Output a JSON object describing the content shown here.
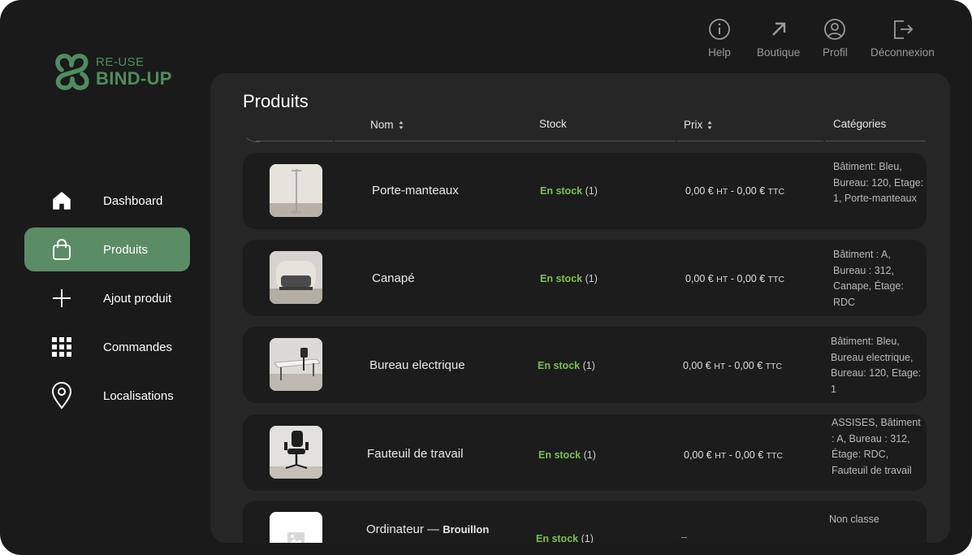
{
  "brand": {
    "line1": "RE-USE",
    "line2": "BIND-UP",
    "color": "#4e8e5e"
  },
  "sidebar": {
    "active_color": "#5a8d66",
    "items": [
      {
        "label": "Dashboard",
        "icon": "home-icon"
      },
      {
        "label": "Produits",
        "icon": "shopping-bag-icon",
        "active": true
      },
      {
        "label": "Ajout produit",
        "icon": "plus-icon"
      },
      {
        "label": "Commandes",
        "icon": "grid-icon"
      },
      {
        "label": "Localisations",
        "icon": "map-pin-icon"
      }
    ]
  },
  "topbar": {
    "actions": [
      {
        "label": "Help",
        "icon": "info-icon"
      },
      {
        "label": "Boutique",
        "icon": "arrow-up-right-icon"
      },
      {
        "label": "Profil",
        "icon": "user-circle-icon"
      },
      {
        "label": "Déconnexion",
        "icon": "logout-icon"
      }
    ]
  },
  "main": {
    "title": "Produits",
    "columns": {
      "name": "Nom",
      "stock": "Stock",
      "price": "Prix",
      "categories": "Catégories"
    },
    "rows": [
      {
        "name": "Porte-manteaux",
        "stock_label": "En stock",
        "stock_count": "(1)",
        "price_ht": "0,00 €",
        "ht": "HT",
        "sep": "-",
        "price_ttc": "0,00 €",
        "ttc": "TTC",
        "categories": "Bâtiment: Bleu, Bureau: 120, Etage: 1, Porte-manteaux",
        "thumb": "coat-rack-photo"
      },
      {
        "name": "Canapé",
        "stock_label": "En stock",
        "stock_count": "(1)",
        "price_ht": "0,00 €",
        "ht": "HT",
        "sep": "-",
        "price_ttc": "0,00 €",
        "ttc": "TTC",
        "categories": "Bâtiment : A, Bureau : 312, Canape, Étage: RDC",
        "thumb": "sofa-photo"
      },
      {
        "name": "Bureau electrique",
        "stock_label": "En stock",
        "stock_count": "(1)",
        "price_ht": "0,00 €",
        "ht": "HT",
        "sep": "-",
        "price_ttc": "0,00 €",
        "ttc": "TTC",
        "categories": "Bâtiment: Bleu, Bureau electrique, Bureau: 120, Etage: 1",
        "thumb": "desk-photo"
      },
      {
        "name": "Fauteuil de travail",
        "stock_label": "En stock",
        "stock_count": "(1)",
        "price_ht": "0,00 €",
        "ht": "HT",
        "sep": "-",
        "price_ttc": "0,00 €",
        "ttc": "TTC",
        "categories": "ASSISES, Bâtiment : A, Bureau : 312, Étage: RDC, Fauteuil de travail",
        "thumb": "office-chair-photo"
      },
      {
        "name": "Ordinateur",
        "draft_sep": "—",
        "draft": "Brouillon",
        "stock_label": "En stock",
        "stock_count": "(1)",
        "price": "–",
        "categories": "Non classe",
        "thumb": "image-placeholder-icon"
      }
    ]
  }
}
